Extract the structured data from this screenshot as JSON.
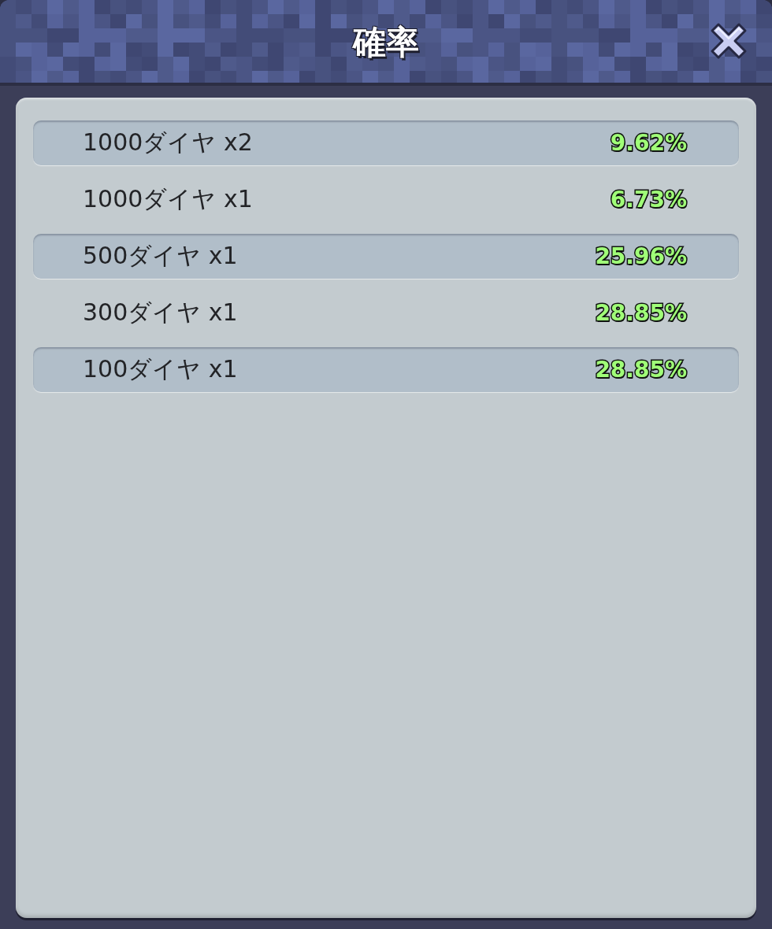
{
  "dialog": {
    "title": "確率"
  },
  "rows": [
    {
      "label": "1000ダイヤ x2",
      "probability": "9.62%"
    },
    {
      "label": "1000ダイヤ x1",
      "probability": "6.73%"
    },
    {
      "label": "500ダイヤ x1",
      "probability": "25.96%"
    },
    {
      "label": "300ダイヤ x1",
      "probability": "28.85%"
    },
    {
      "label": "100ダイヤ x1",
      "probability": "28.85%"
    }
  ]
}
